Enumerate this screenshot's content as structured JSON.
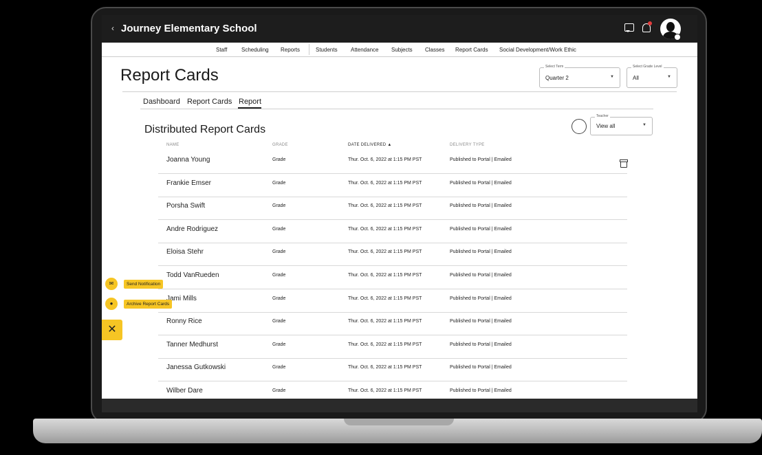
{
  "app": {
    "school_name": "Journey Elementary School"
  },
  "nav": {
    "items": [
      "Staff",
      "Scheduling",
      "Reports",
      "Students",
      "Attendance",
      "Subjects",
      "Classes",
      "Report Cards",
      "Social Development/Work Ethic"
    ]
  },
  "page": {
    "title": "Report Cards"
  },
  "filters": {
    "term_label": "Select Term",
    "term_value": "Quarter 2",
    "grade_label": "Select Grade Level",
    "grade_value": "All",
    "teacher_label": "Teacher",
    "teacher_value": "View all"
  },
  "tabs": [
    "Dashboard",
    "Report Cards",
    "Report"
  ],
  "active_tab": "Report",
  "section": {
    "title": "Distributed Report Cards"
  },
  "table": {
    "columns": [
      "NAME",
      "GRADE",
      "DATE DELIVERED ▲",
      "DELIVERY TYPE"
    ],
    "rows": [
      {
        "name": "Joanna Young",
        "grade": "Grade",
        "date": "Thur. Oct. 6, 2022 at 1:15 PM PST",
        "type": "Published to Portal | Emailed"
      },
      {
        "name": "Frankie Emser",
        "grade": "Grade",
        "date": "Thur. Oct. 6, 2022 at 1:15 PM PST",
        "type": "Published to Portal | Emailed"
      },
      {
        "name": "Porsha Swift",
        "grade": "Grade",
        "date": "Thur. Oct. 6, 2022 at 1:15 PM PST",
        "type": "Published to Portal | Emailed"
      },
      {
        "name": "Andre Rodriguez",
        "grade": "Grade",
        "date": "Thur. Oct. 6, 2022 at 1:15 PM PST",
        "type": "Published to Portal | Emailed"
      },
      {
        "name": "Eloisa Stehr",
        "grade": "Grade",
        "date": "Thur. Oct. 6, 2022 at 1:15 PM PST",
        "type": "Published to Portal | Emailed"
      },
      {
        "name": "Todd VanRueden",
        "grade": "Grade",
        "date": "Thur. Oct. 6, 2022 at 1:15 PM PST",
        "type": "Published to Portal | Emailed"
      },
      {
        "name": "Jami Mills",
        "grade": "Grade",
        "date": "Thur. Oct. 6, 2022 at 1:15 PM PST",
        "type": "Published to Portal | Emailed"
      },
      {
        "name": "Ronny Rice",
        "grade": "Grade",
        "date": "Thur. Oct. 6, 2022 at 1:15 PM PST",
        "type": "Published to Portal | Emailed"
      },
      {
        "name": "Tanner Medhurst",
        "grade": "Grade",
        "date": "Thur. Oct. 6, 2022 at 1:15 PM PST",
        "type": "Published to Portal | Emailed"
      },
      {
        "name": "Janessa Gutkowski",
        "grade": "Grade",
        "date": "Thur. Oct. 6, 2022 at 1:15 PM PST",
        "type": "Published to Portal | Emailed"
      },
      {
        "name": "Wilber Dare",
        "grade": "Grade",
        "date": "Thur. Oct. 6, 2022 at 1:15 PM PST",
        "type": "Published to Portal | Emailed"
      }
    ]
  },
  "fab": {
    "send_notification": "Send Notification",
    "archive_report_cards": "Archive Report Cards",
    "close": "✕"
  },
  "colors": {
    "accent": "#f6c524",
    "titlebar": "#1d1d1d",
    "notification_dot": "#e23b3b"
  }
}
